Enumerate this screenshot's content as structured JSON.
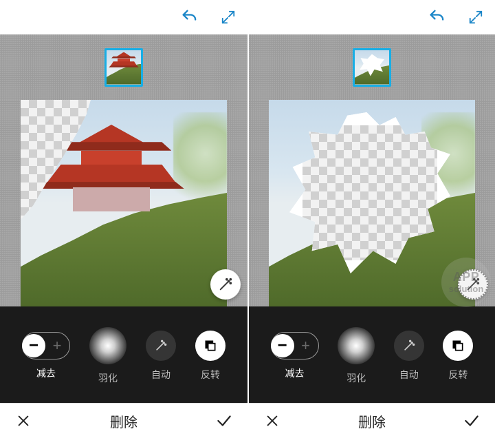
{
  "topbar": {
    "undo_icon": "undo-icon",
    "expand_icon": "expand-icon"
  },
  "tools": {
    "subtract": {
      "label": "减去",
      "minus": "−",
      "plus": "+"
    },
    "feather": {
      "label": "羽化"
    },
    "auto": {
      "label": "自动"
    },
    "invert": {
      "label": "反转"
    }
  },
  "bottombar": {
    "title": "删除",
    "cancel_icon": "close-icon",
    "confirm_icon": "check-icon"
  },
  "watermark": {
    "line1": "APP",
    "line2": "solution"
  },
  "colors": {
    "accent": "#1b86c8",
    "thumb_border": "#18aee5",
    "pagoda": "#b53624"
  }
}
